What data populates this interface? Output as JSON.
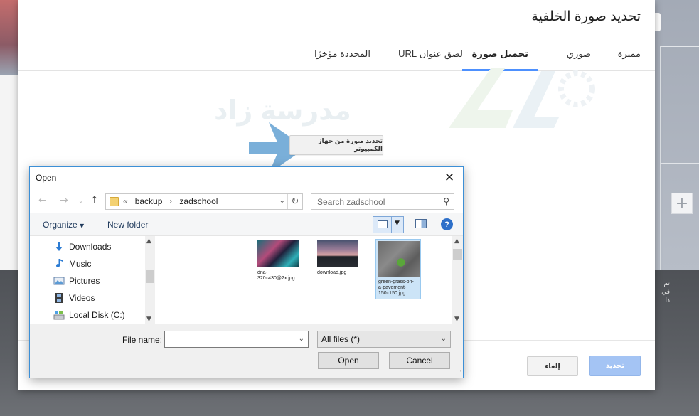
{
  "dialog": {
    "title": "تحديد صورة الخلفية",
    "tabs": [
      {
        "label": "مميزة"
      },
      {
        "label": "صوري"
      },
      {
        "label": "تحميل صورة",
        "active": true
      },
      {
        "label": "لصق عنوان URL"
      },
      {
        "label": "المحددة مؤخرًا"
      }
    ],
    "watermark_text": "مدرسة زاد",
    "upload_button": "تحديد صورة من جهاز الكمبيوتر",
    "select_button": "تحديد",
    "cancel_button": "إلغاء"
  },
  "background": {
    "right_text": "تم\nفي\nذا"
  },
  "open_dialog": {
    "title": "Open",
    "address": {
      "prefix": "«",
      "crumbs": [
        "backup",
        "zadschool"
      ]
    },
    "search_placeholder": "Search zadschool",
    "toolbar": {
      "organize": "Organize",
      "new_folder": "New folder"
    },
    "nav_items": [
      {
        "label": "Downloads",
        "icon": "download-arrow-icon"
      },
      {
        "label": "Music",
        "icon": "music-note-icon"
      },
      {
        "label": "Pictures",
        "icon": "pictures-icon"
      },
      {
        "label": "Videos",
        "icon": "film-icon"
      },
      {
        "label": "Local Disk (C:)",
        "icon": "disk-drive-icon"
      }
    ],
    "files": [
      {
        "name": "dna-320x430@2x.jpg"
      },
      {
        "name": "download.jpg"
      },
      {
        "name": "green-grass-on-a-pavement-150x150.jpg",
        "selected": true
      }
    ],
    "file_name_label": "File name:",
    "file_name_value": "",
    "file_type": "All files (*)",
    "open_button": "Open",
    "cancel_button": "Cancel"
  },
  "colors": {
    "accent_tab": "#4d90fe",
    "select_button": "#a4c4f4",
    "dialog_border": "#3c8fd6",
    "help_icon": "#2d6fc9",
    "arrow": "#6fa8d6"
  }
}
